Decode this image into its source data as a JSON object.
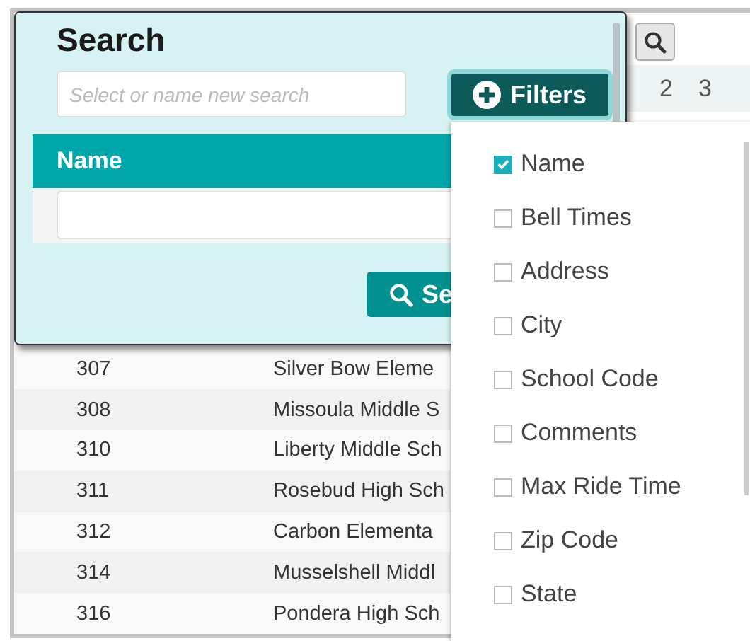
{
  "toolbar": {
    "pages": [
      "2",
      "3"
    ]
  },
  "table": {
    "rows": [
      {
        "code": "307",
        "name": "Silver Bow Eleme"
      },
      {
        "code": "308",
        "name": "Missoula Middle S"
      },
      {
        "code": "310",
        "name": "Liberty Middle Sch"
      },
      {
        "code": "311",
        "name": "Rosebud High Sch"
      },
      {
        "code": "312",
        "name": "Carbon Elementa"
      },
      {
        "code": "314",
        "name": "Musselshell Middl"
      },
      {
        "code": "316",
        "name": "Pondera High Sch"
      }
    ]
  },
  "search_panel": {
    "title": "Search",
    "search_field": {
      "placeholder": "Select or name new search"
    },
    "filters_button": "Filters",
    "name_filter": {
      "label": "Name"
    },
    "search_button": "Se"
  },
  "filters_menu": {
    "items": [
      {
        "label": "Name",
        "checked": true
      },
      {
        "label": "Bell Times",
        "checked": false
      },
      {
        "label": "Address",
        "checked": false
      },
      {
        "label": "City",
        "checked": false
      },
      {
        "label": "School Code",
        "checked": false
      },
      {
        "label": "Comments",
        "checked": false
      },
      {
        "label": "Max Ride Time",
        "checked": false
      },
      {
        "label": "Zip Code",
        "checked": false
      },
      {
        "label": "State",
        "checked": false
      }
    ]
  }
}
